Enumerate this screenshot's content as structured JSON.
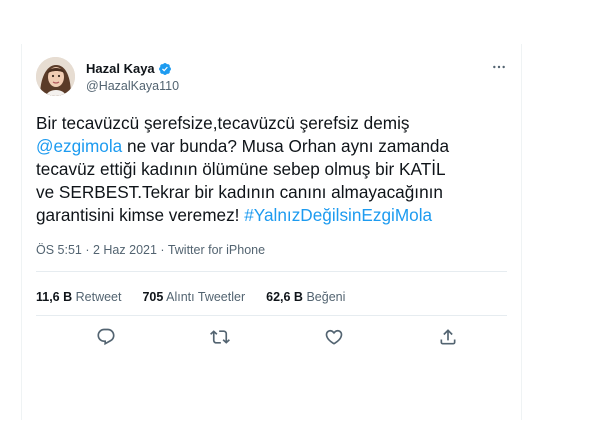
{
  "tweet": {
    "author": {
      "display_name": "Hazal Kaya",
      "handle": "@HazalKaya110",
      "verified": true,
      "avatar_icon": "profile-photo"
    },
    "text_parts": [
      "Bir tecavüzcü şerefsize,tecavüzcü şerefsiz demiş\n",
      "@ezgimola",
      " ne var bunda? Musa Orhan aynı zamanda\ntecavüz ettiği kadının ölümüne sebep olmuş bir KATİL\nve SERBEST.Tekrar bir kadının canını almayacağının\ngarantisini kimse veremez! ",
      "#YalnızDeğilsinEzgiMola"
    ],
    "time": "ÖS 5:51",
    "separator": " · ",
    "date": "2 Haz 2021",
    "source": "Twitter for iPhone"
  },
  "stats": {
    "retweets_count": "11,6 B",
    "retweets_label": "Retweet",
    "quotes_count": "705",
    "quotes_label": "Alıntı Tweetler",
    "likes_count": "62,6 B",
    "likes_label": "Beğeni"
  },
  "actions": [
    "reply-icon",
    "retweet-icon",
    "like-icon",
    "share-icon"
  ],
  "colors": {
    "link": "#1d9bf0",
    "verified": "#1d9bf0",
    "text": "#0f1419",
    "secondary": "#536471",
    "divider": "#e6ecf0"
  }
}
